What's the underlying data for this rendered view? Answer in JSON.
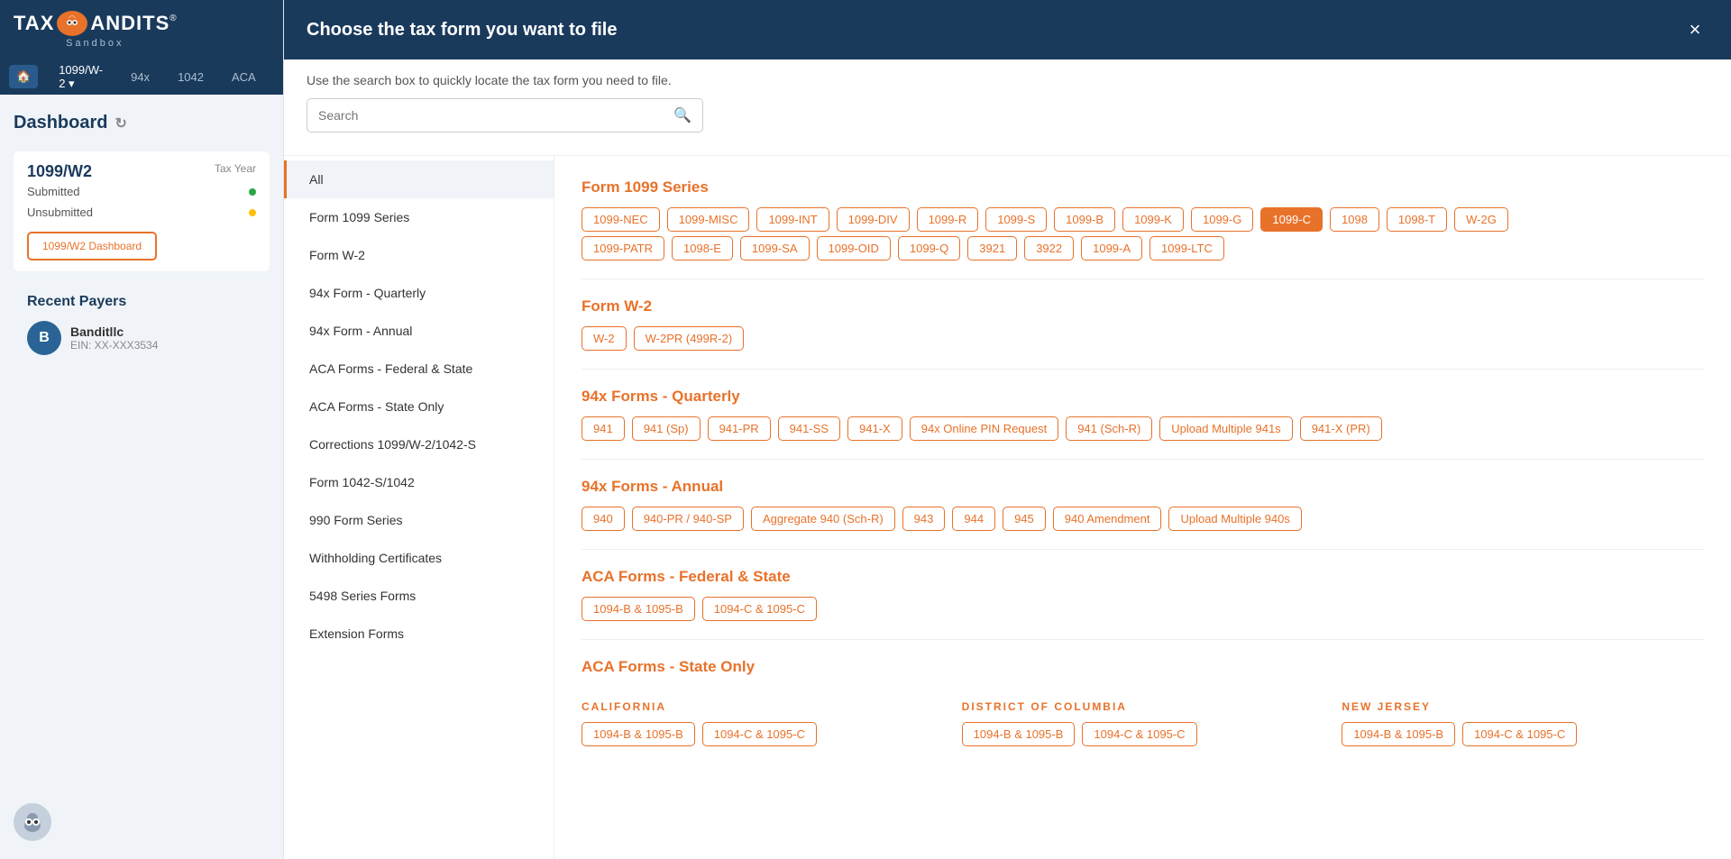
{
  "app": {
    "name": "TaxBandits",
    "subtitle": "Sandbox"
  },
  "nav": {
    "items": [
      {
        "label": "🏠",
        "id": "home",
        "active": true
      },
      {
        "label": "1099/W-2",
        "id": "1099w2",
        "hasDropdown": true
      },
      {
        "label": "94x",
        "id": "94x"
      },
      {
        "label": "1042",
        "id": "1042"
      },
      {
        "label": "ACA",
        "id": "aca"
      },
      {
        "label": "🖨",
        "id": "print"
      }
    ]
  },
  "sidebar": {
    "dashboard_title": "Dashboard",
    "form_section": {
      "label": "Tax Year",
      "title": "1099/W2"
    },
    "submitted_label": "Submitted",
    "unsubmitted_label": "Unsubmitted",
    "dashboard_btn": "1099/W2 Dashboard",
    "recent_payers_title": "Recent Payers",
    "payer": {
      "initial": "B",
      "name": "Banditllc",
      "ein": "EIN: XX-XXX3534"
    }
  },
  "modal": {
    "title": "Choose the tax form you want to file",
    "subtitle": "Use the search box to quickly locate the tax form you need to file.",
    "close_label": "×",
    "search_placeholder": "Search",
    "categories": [
      {
        "label": "All",
        "id": "all",
        "active": true
      },
      {
        "label": "Form 1099 Series",
        "id": "1099"
      },
      {
        "label": "Form W-2",
        "id": "w2"
      },
      {
        "label": "94x Form - Quarterly",
        "id": "94x-quarterly"
      },
      {
        "label": "94x Form - Annual",
        "id": "94x-annual"
      },
      {
        "label": "ACA Forms - Federal & State",
        "id": "aca-federal"
      },
      {
        "label": "ACA Forms - State Only",
        "id": "aca-state"
      },
      {
        "label": "Corrections 1099/W-2/1042-S",
        "id": "corrections"
      },
      {
        "label": "Form 1042-S/1042",
        "id": "1042s"
      },
      {
        "label": "990 Form Series",
        "id": "990"
      },
      {
        "label": "Withholding Certificates",
        "id": "withholding"
      },
      {
        "label": "5498 Series Forms",
        "id": "5498"
      },
      {
        "label": "Extension Forms",
        "id": "extension"
      }
    ],
    "sections": {
      "form1099": {
        "title": "Form 1099 Series",
        "chips": [
          {
            "label": "1099-NEC",
            "active": false
          },
          {
            "label": "1099-MISC",
            "active": false
          },
          {
            "label": "1099-INT",
            "active": false
          },
          {
            "label": "1099-DIV",
            "active": false
          },
          {
            "label": "1099-R",
            "active": false
          },
          {
            "label": "1099-S",
            "active": false
          },
          {
            "label": "1099-B",
            "active": false
          },
          {
            "label": "1099-K",
            "active": false
          },
          {
            "label": "1099-G",
            "active": false
          },
          {
            "label": "1099-C",
            "active": true
          },
          {
            "label": "1098",
            "active": false
          },
          {
            "label": "1098-T",
            "active": false
          },
          {
            "label": "W-2G",
            "active": false
          },
          {
            "label": "1099-PATR",
            "active": false
          },
          {
            "label": "1098-E",
            "active": false
          },
          {
            "label": "1099-SA",
            "active": false
          },
          {
            "label": "1099-OID",
            "active": false
          },
          {
            "label": "1099-Q",
            "active": false
          },
          {
            "label": "3921",
            "active": false
          },
          {
            "label": "3922",
            "active": false
          },
          {
            "label": "1099-A",
            "active": false
          },
          {
            "label": "1099-LTC",
            "active": false
          }
        ]
      },
      "formW2": {
        "title": "Form W-2",
        "chips": [
          {
            "label": "W-2",
            "active": false
          },
          {
            "label": "W-2PR (499R-2)",
            "active": false
          }
        ]
      },
      "form94xQuarterly": {
        "title": "94x Forms - Quarterly",
        "chips": [
          {
            "label": "941",
            "active": false
          },
          {
            "label": "941 (Sp)",
            "active": false
          },
          {
            "label": "941-PR",
            "active": false
          },
          {
            "label": "941-SS",
            "active": false
          },
          {
            "label": "941-X",
            "active": false
          },
          {
            "label": "94x Online PIN Request",
            "active": false
          },
          {
            "label": "941 (Sch-R)",
            "active": false
          },
          {
            "label": "Upload Multiple 941s",
            "active": false
          },
          {
            "label": "941-X (PR)",
            "active": false
          }
        ]
      },
      "form94xAnnual": {
        "title": "94x Forms - Annual",
        "chips": [
          {
            "label": "940",
            "active": false
          },
          {
            "label": "940-PR / 940-SP",
            "active": false
          },
          {
            "label": "Aggregate 940 (Sch-R)",
            "active": false
          },
          {
            "label": "943",
            "active": false
          },
          {
            "label": "944",
            "active": false
          },
          {
            "label": "945",
            "active": false
          },
          {
            "label": "940 Amendment",
            "active": false
          },
          {
            "label": "Upload Multiple 940s",
            "active": false
          }
        ]
      },
      "acaFederal": {
        "title": "ACA Forms - Federal & State",
        "chips": [
          {
            "label": "1094-B & 1095-B",
            "active": false
          },
          {
            "label": "1094-C & 1095-C",
            "active": false
          }
        ]
      },
      "acaState": {
        "title": "ACA Forms - State Only",
        "states": [
          {
            "name": "CALIFORNIA",
            "chips": [
              {
                "label": "1094-B & 1095-B",
                "active": false
              },
              {
                "label": "1094-C & 1095-C",
                "active": false
              }
            ]
          },
          {
            "name": "DISTRICT OF COLUMBIA",
            "chips": [
              {
                "label": "1094-B & 1095-B",
                "active": false
              },
              {
                "label": "1094-C & 1095-C",
                "active": false
              }
            ]
          },
          {
            "name": "NEW JERSEY",
            "chips": [
              {
                "label": "1094-B & 1095-B",
                "active": false
              },
              {
                "label": "1094-C & 1095-C",
                "active": false
              }
            ]
          }
        ]
      }
    }
  }
}
